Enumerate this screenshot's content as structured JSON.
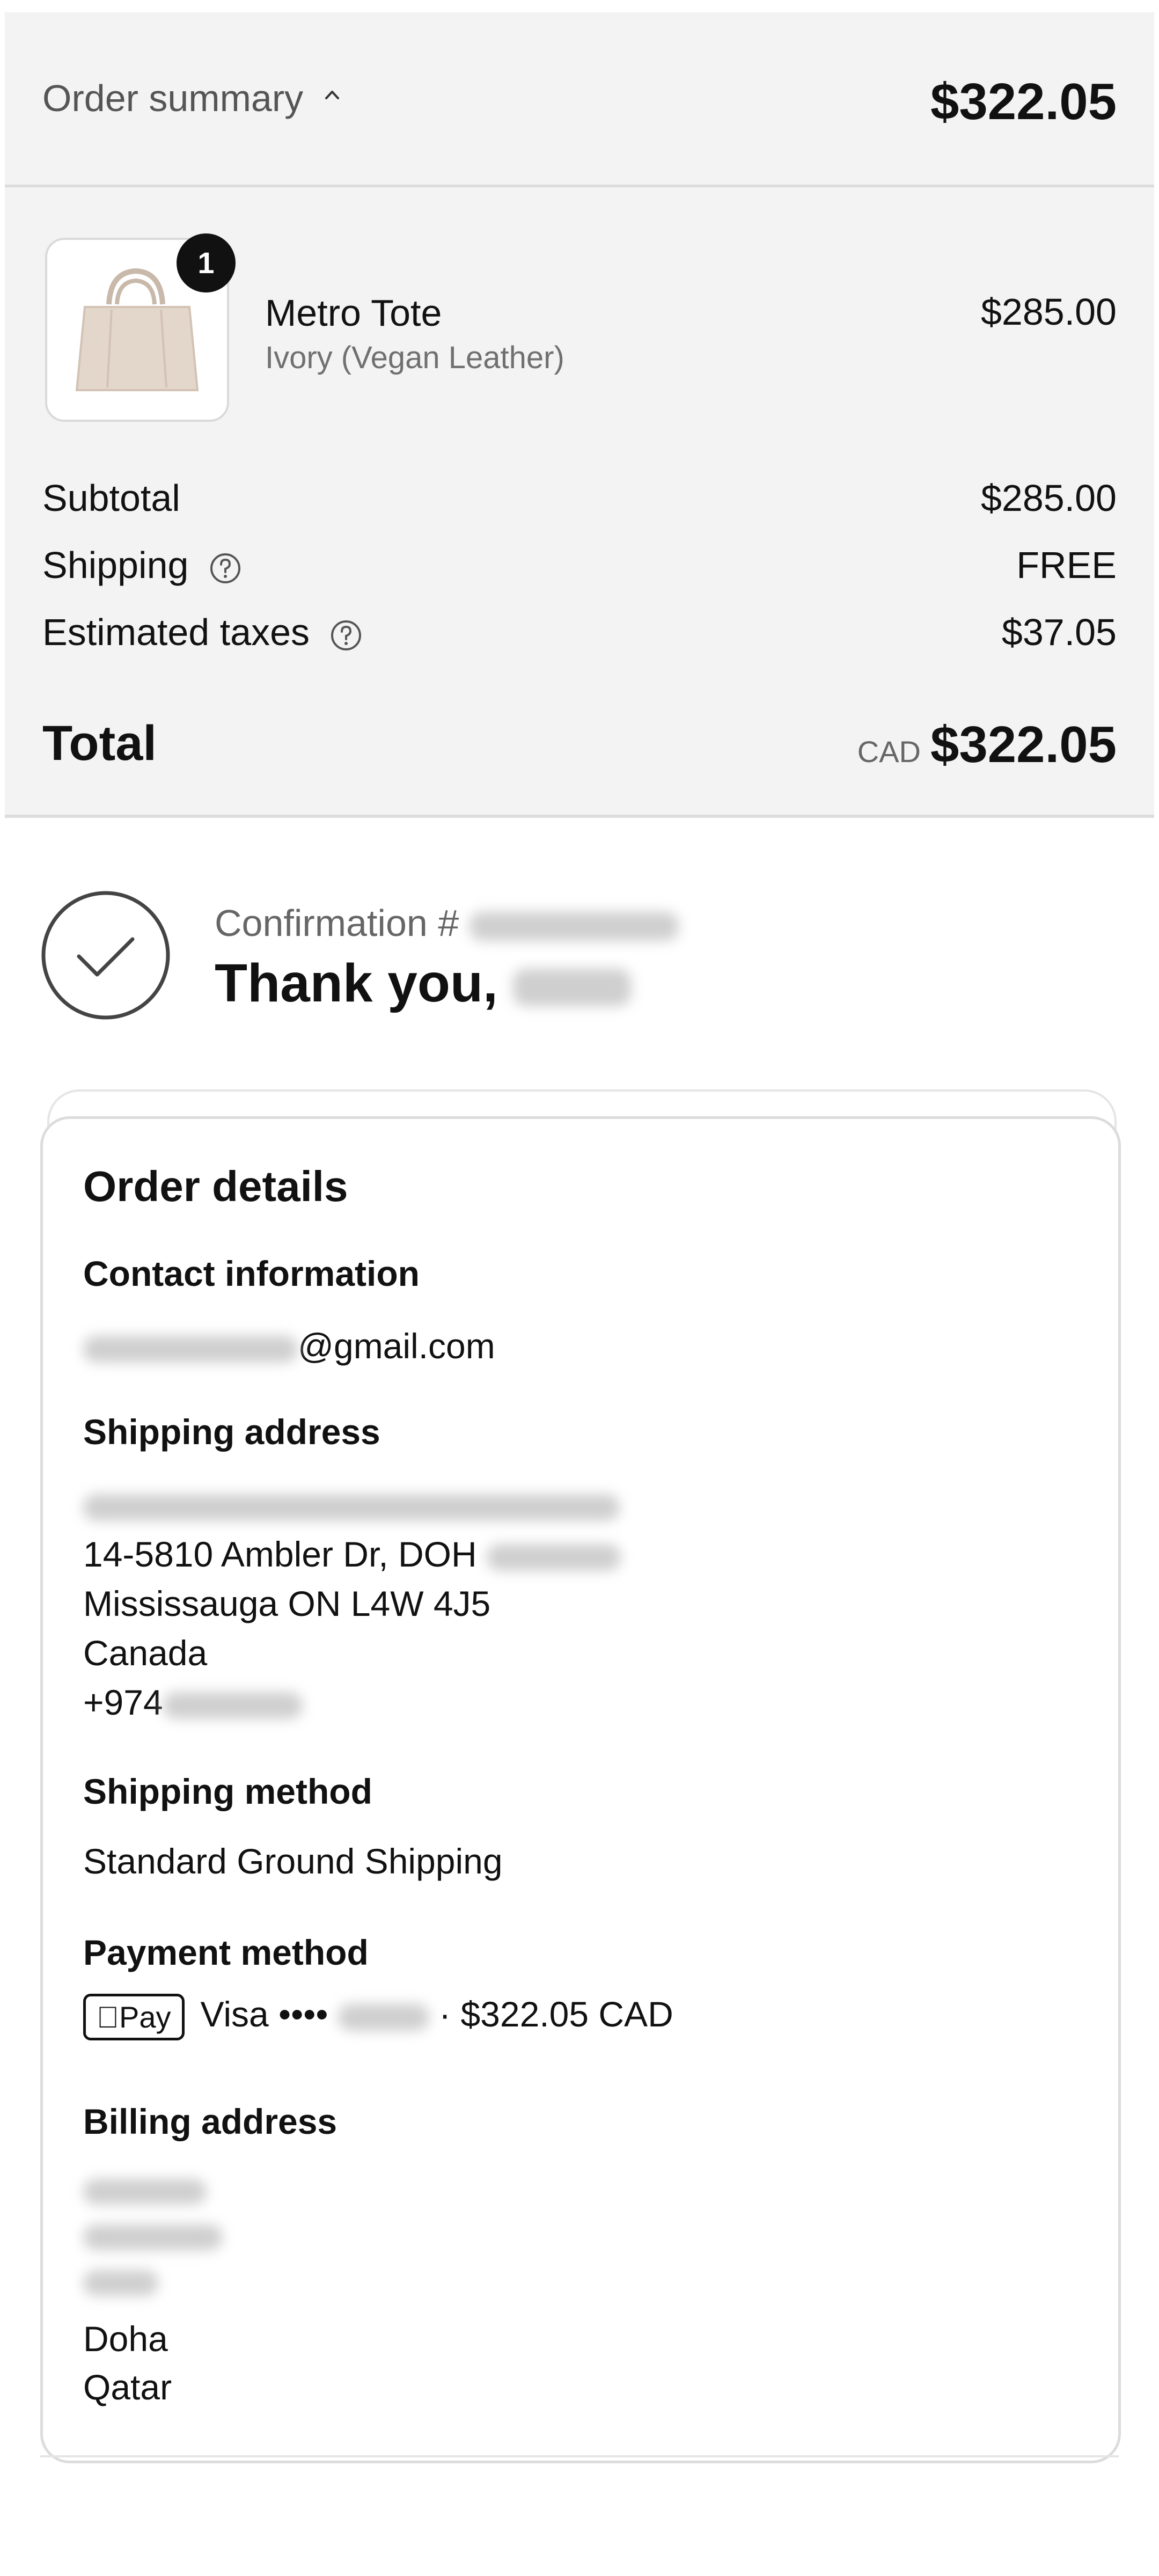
{
  "order_summary": {
    "title": "Order summary",
    "total_top": "$322.05",
    "item": {
      "quantity": "1",
      "name": "Metro Tote",
      "variant": "Ivory (Vegan Leather)",
      "price": "$285.00"
    },
    "subtotal_label": "Subtotal",
    "subtotal_value": "$285.00",
    "shipping_label": "Shipping",
    "shipping_value": "FREE",
    "taxes_label": "Estimated taxes",
    "taxes_value": "$37.05",
    "total_label": "Total",
    "currency": "CAD",
    "total_value": "$322.05"
  },
  "confirmation": {
    "label": "Confirmation #",
    "thanks": "Thank you,"
  },
  "order_details": {
    "title": "Order details",
    "contact_title": "Contact information",
    "email_suffix": "@gmail.com",
    "shipping_title": "Shipping address",
    "address_line2": "14-5810 Ambler Dr, DOH",
    "address_line3": "Mississauga ON L4W 4J5",
    "address_country": "Canada",
    "phone_prefix": "+974",
    "method_title": "Shipping method",
    "method_value": "Standard Ground Shipping",
    "payment_title": "Payment method",
    "payment_badge": "Pay",
    "payment_card": "Visa ••••",
    "payment_amount": "· $322.05 CAD",
    "billing_title": "Billing address",
    "billing_city": "Doha",
    "billing_country": "Qatar"
  },
  "colors": {
    "summary_bg": "#f3f3f3",
    "text": "#111111",
    "muted": "#666666"
  }
}
